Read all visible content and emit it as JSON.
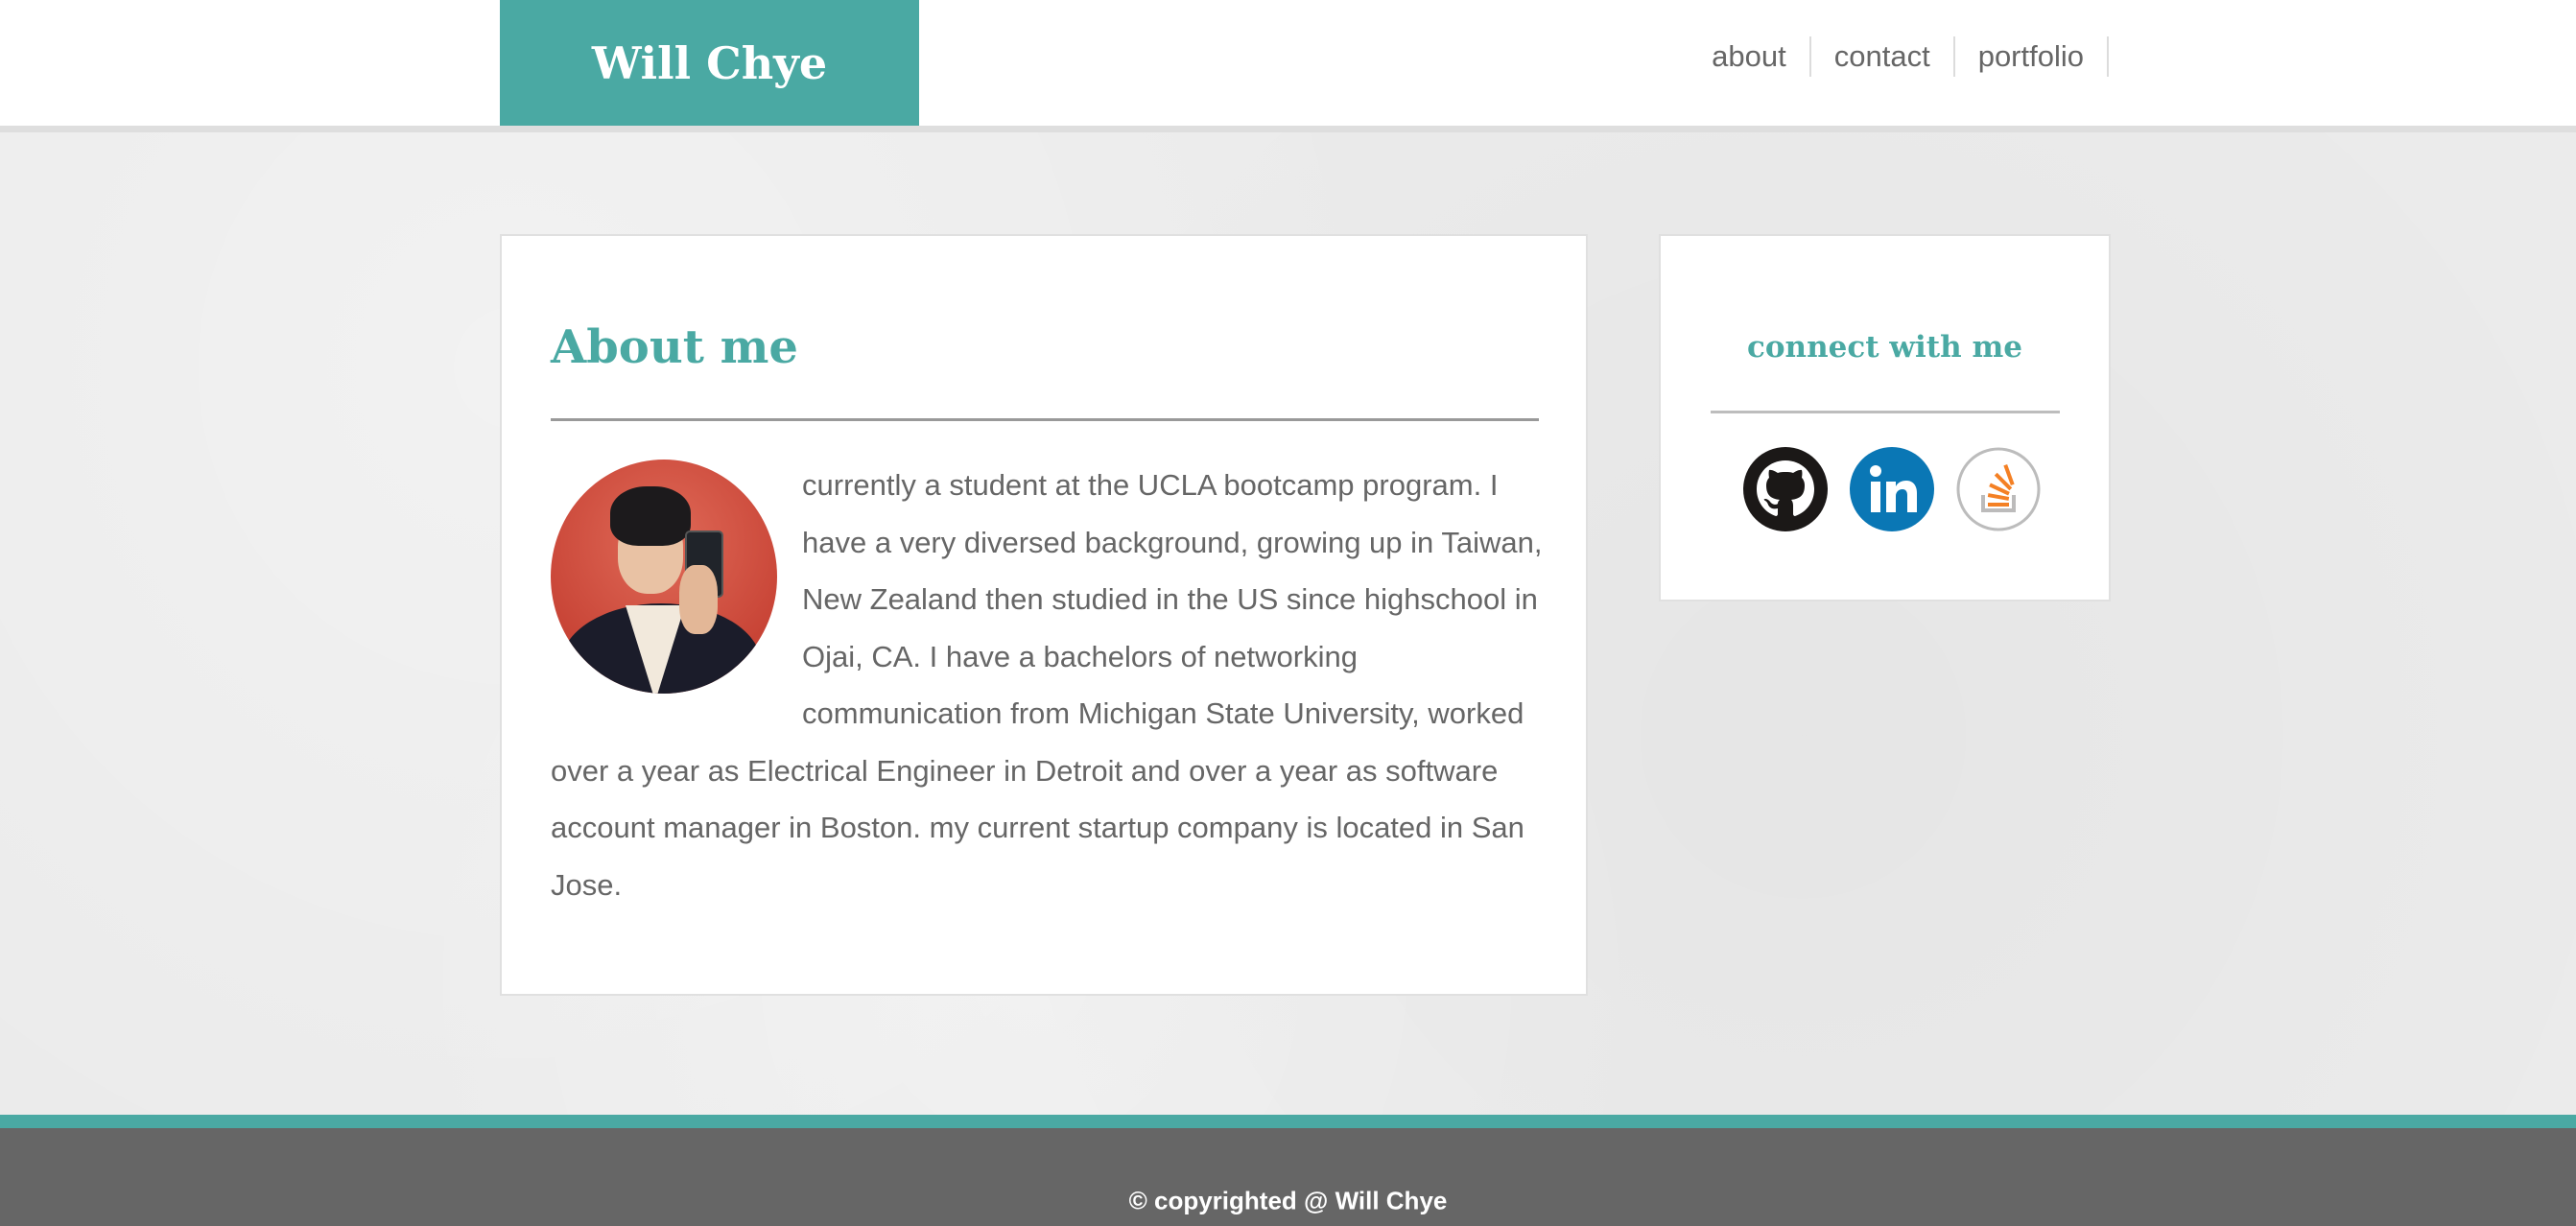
{
  "header": {
    "brand": "Will Chye",
    "nav": [
      {
        "label": "about"
      },
      {
        "label": "contact"
      },
      {
        "label": "portfolio"
      }
    ]
  },
  "about": {
    "title": "About me",
    "bio": "currently a student at the UCLA bootcamp program. I have a very diversed background, growing up in Taiwan, New Zealand then studied in the US since highschool in Ojai, CA. I have a bachelors of networking communication from Michigan State University, worked over a year as Electrical Engineer in Detroit and over a year as software account manager in Boston. my current startup company is located in San Jose."
  },
  "connect": {
    "title": "connect with me",
    "links": [
      {
        "icon": "github-icon"
      },
      {
        "icon": "linkedin-icon"
      },
      {
        "icon": "stackoverflow-icon"
      }
    ]
  },
  "footer": {
    "text": "© copyrighted @ Will Chye"
  },
  "colors": {
    "accent": "#4aa9a3",
    "text": "#666666",
    "footer_bg": "#666666",
    "linkedin": "#0a77b5",
    "stackoverflow": "#f48024"
  }
}
